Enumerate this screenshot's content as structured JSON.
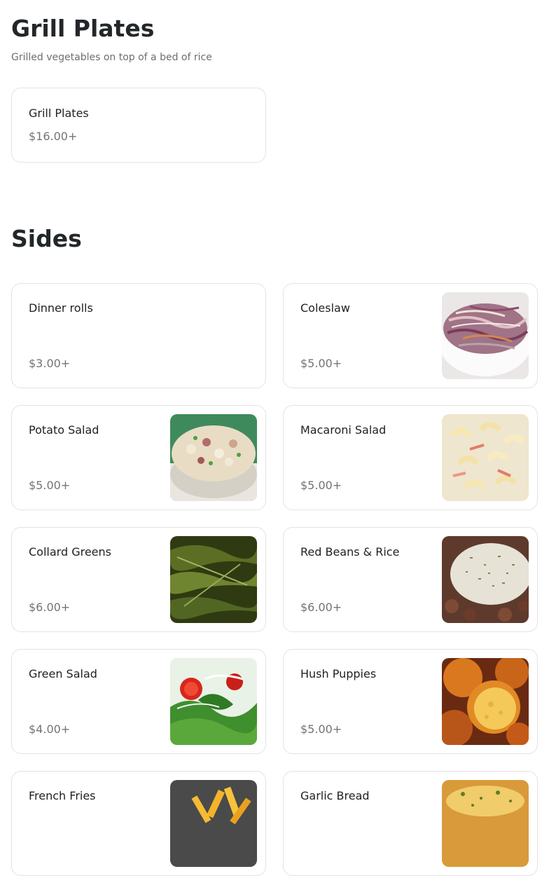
{
  "sections": [
    {
      "title": "Grill Plates",
      "description": "Grilled vegetables on top of a bed of rice",
      "items": [
        {
          "name": "Grill Plates",
          "price": "$16.00+"
        }
      ]
    },
    {
      "title": "Sides",
      "items": [
        {
          "name": "Dinner rolls",
          "price": "$3.00+"
        },
        {
          "name": "Coleslaw",
          "price": "$5.00+",
          "image": "coleslaw-photo"
        },
        {
          "name": "Potato Salad",
          "price": "$5.00+",
          "image": "potato-salad-photo"
        },
        {
          "name": "Macaroni Salad",
          "price": "$5.00+",
          "image": "macaroni-salad-photo"
        },
        {
          "name": "Collard Greens",
          "price": "$6.00+",
          "image": "collard-greens-photo"
        },
        {
          "name": "Red Beans & Rice",
          "price": "$6.00+",
          "image": "red-beans-rice-photo"
        },
        {
          "name": "Green Salad",
          "price": "$4.00+",
          "image": "green-salad-photo"
        },
        {
          "name": "Hush Puppies",
          "price": "$5.00+",
          "image": "hush-puppies-photo"
        },
        {
          "name": "French Fries",
          "image": "french-fries-photo"
        },
        {
          "name": "Garlic Bread",
          "image": "garlic-bread-photo"
        }
      ]
    }
  ]
}
